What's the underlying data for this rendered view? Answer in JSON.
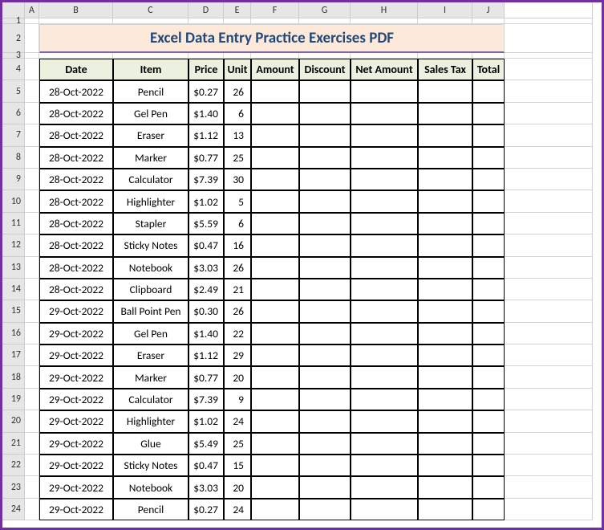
{
  "title": "Excel Data Entry Practice Exercises PDF",
  "columns_letters": [
    "A",
    "B",
    "C",
    "D",
    "E",
    "F",
    "G",
    "H",
    "I",
    "J"
  ],
  "headers": [
    "Date",
    "Item",
    "Price",
    "Unit",
    "Amount",
    "Discount",
    "Net Amount",
    "Sales Tax",
    "Total"
  ],
  "chart_data": {
    "type": "table",
    "columns": [
      "Date",
      "Item",
      "Price",
      "Unit",
      "Amount",
      "Discount",
      "Net Amount",
      "Sales Tax",
      "Total"
    ],
    "rows": [
      [
        "28-Oct-2022",
        "Pencil",
        "$0.27",
        "26",
        "",
        "",
        "",
        "",
        ""
      ],
      [
        "28-Oct-2022",
        "Gel Pen",
        "$1.40",
        "6",
        "",
        "",
        "",
        "",
        ""
      ],
      [
        "28-Oct-2022",
        "Eraser",
        "$1.12",
        "13",
        "",
        "",
        "",
        "",
        ""
      ],
      [
        "28-Oct-2022",
        "Marker",
        "$0.77",
        "25",
        "",
        "",
        "",
        "",
        ""
      ],
      [
        "28-Oct-2022",
        "Calculator",
        "$7.39",
        "30",
        "",
        "",
        "",
        "",
        ""
      ],
      [
        "28-Oct-2022",
        "Highlighter",
        "$1.02",
        "5",
        "",
        "",
        "",
        "",
        ""
      ],
      [
        "28-Oct-2022",
        "Stapler",
        "$5.59",
        "6",
        "",
        "",
        "",
        "",
        ""
      ],
      [
        "28-Oct-2022",
        "Sticky Notes",
        "$0.47",
        "16",
        "",
        "",
        "",
        "",
        ""
      ],
      [
        "28-Oct-2022",
        "Notebook",
        "$3.03",
        "26",
        "",
        "",
        "",
        "",
        ""
      ],
      [
        "28-Oct-2022",
        "Clipboard",
        "$2.49",
        "21",
        "",
        "",
        "",
        "",
        ""
      ],
      [
        "29-Oct-2022",
        "Ball Point Pen",
        "$0.30",
        "26",
        "",
        "",
        "",
        "",
        ""
      ],
      [
        "29-Oct-2022",
        "Gel Pen",
        "$1.40",
        "22",
        "",
        "",
        "",
        "",
        ""
      ],
      [
        "29-Oct-2022",
        "Eraser",
        "$1.12",
        "29",
        "",
        "",
        "",
        "",
        ""
      ],
      [
        "29-Oct-2022",
        "Marker",
        "$0.77",
        "20",
        "",
        "",
        "",
        "",
        ""
      ],
      [
        "29-Oct-2022",
        "Calculator",
        "$7.39",
        "9",
        "",
        "",
        "",
        "",
        ""
      ],
      [
        "29-Oct-2022",
        "Highlighter",
        "$1.02",
        "24",
        "",
        "",
        "",
        "",
        ""
      ],
      [
        "29-Oct-2022",
        "Glue",
        "$5.49",
        "25",
        "",
        "",
        "",
        "",
        ""
      ],
      [
        "29-Oct-2022",
        "Sticky Notes",
        "$0.47",
        "15",
        "",
        "",
        "",
        "",
        ""
      ],
      [
        "29-Oct-2022",
        "Notebook",
        "$3.03",
        "20",
        "",
        "",
        "",
        "",
        ""
      ],
      [
        "29-Oct-2022",
        "Pencil",
        "$0.27",
        "24",
        "",
        "",
        "",
        "",
        ""
      ]
    ]
  },
  "row_numbers": [
    1,
    2,
    3,
    4,
    5,
    6,
    7,
    8,
    9,
    10,
    11,
    12,
    13,
    14,
    15,
    16,
    17,
    18,
    19,
    20,
    21,
    22,
    23,
    24
  ]
}
